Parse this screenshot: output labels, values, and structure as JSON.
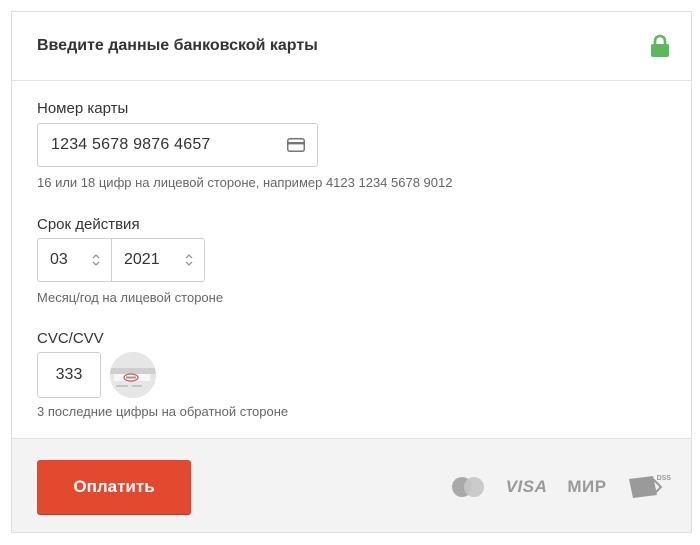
{
  "header": {
    "title": "Введите данные банковской карты",
    "lock_icon": "lock-icon",
    "lock_color": "#5cb85c"
  },
  "card_number": {
    "label": "Номер карты",
    "value": "1234 5678 9876 4657",
    "icon": "credit-card-icon",
    "hint": "16 или 18 цифр на лицевой стороне, например 4123 1234 5678 9012"
  },
  "expiry": {
    "label": "Срок действия",
    "month": "03",
    "year": "2021",
    "hint": "Месяц/год на лицевой стороне"
  },
  "cvc": {
    "label": "CVC/CVV",
    "value": "333",
    "hint": "3 последние цифры на обратной стороне"
  },
  "footer": {
    "pay_label": "Оплатить",
    "pay_color": "#e2492f",
    "logos": {
      "visa": "VISA",
      "mir": "МИР",
      "pci": "DSS"
    }
  }
}
